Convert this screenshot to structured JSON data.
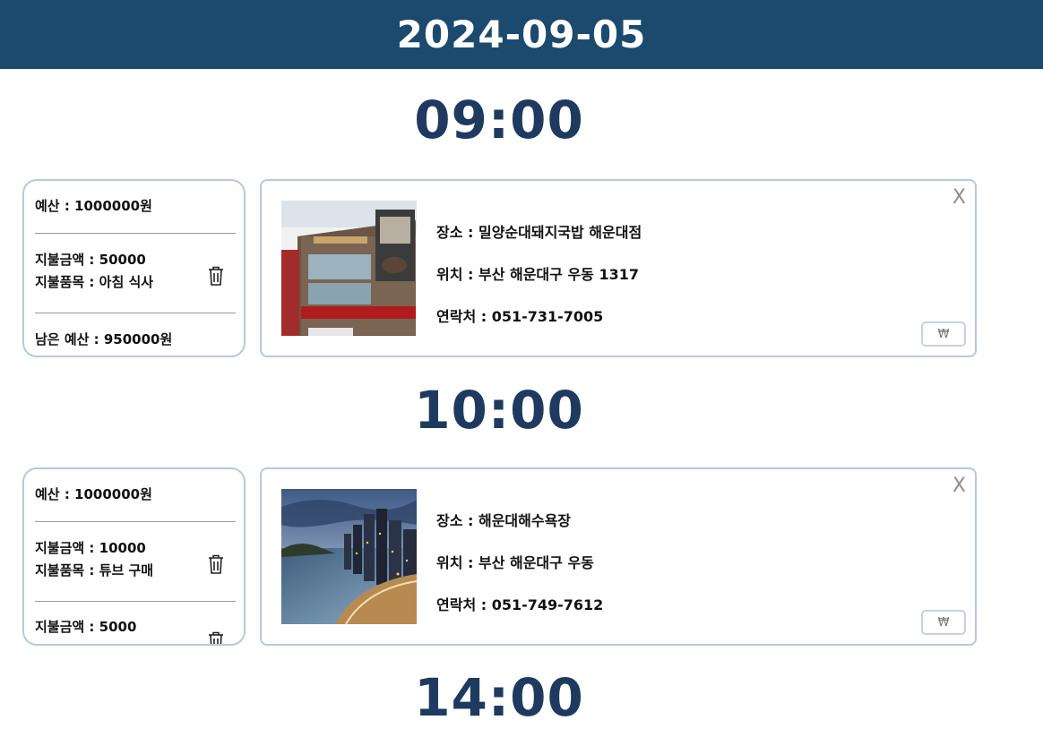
{
  "header": {
    "date": "2024-09-05"
  },
  "slots": [
    {
      "time": "09:00",
      "budget": {
        "budget_label": "예산 : 1000000원",
        "payments": [
          {
            "amount": "지불금액 : 50000",
            "item": "지불품목 : 아침 식사"
          }
        ],
        "remaining": "남은 예산 : 950000원"
      },
      "place": {
        "image": "restaurant-building-photo",
        "name": "장소 : 밀양순대돼지국밥 해운대점",
        "location": "위치 : 부산 해운대구 우동 1317",
        "contact": "연락처 : 051-731-7005",
        "close_label": "X",
        "won_label": "₩"
      }
    },
    {
      "time": "10:00",
      "budget": {
        "budget_label": "예산 : 1000000원",
        "payments": [
          {
            "amount": "지불금액 : 10000",
            "item": "지불품목 : 튜브 구매"
          },
          {
            "amount": "지불금액 : 5000"
          }
        ]
      },
      "place": {
        "image": "haeundae-beach-photo",
        "name": "장소 : 해운대해수욕장",
        "location": "위치 : 부산 해운대구 우동",
        "contact": "연락처 : 051-749-7612",
        "close_label": "X",
        "won_label": "₩"
      }
    },
    {
      "time": "14:00"
    }
  ],
  "icons": {
    "trash": "trash-icon",
    "close": "close-icon",
    "won": "won-icon"
  }
}
